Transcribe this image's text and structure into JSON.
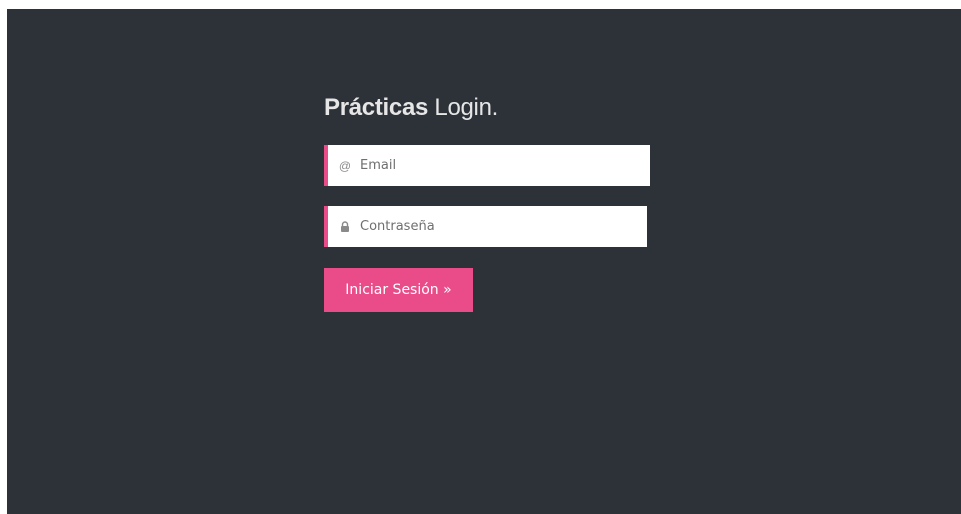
{
  "login": {
    "title_brand": "Prácticas",
    "title_rest": " Login.",
    "email": {
      "icon": "at-icon",
      "icon_glyph": "@",
      "placeholder": "Email",
      "value": ""
    },
    "password": {
      "icon": "lock-icon",
      "placeholder": "Contraseña",
      "value": ""
    },
    "submit_label": "Iniciar Sesión »"
  },
  "colors": {
    "background": "#2d3238",
    "accent": "#ea4c89",
    "title_text": "#e6e6e6"
  }
}
